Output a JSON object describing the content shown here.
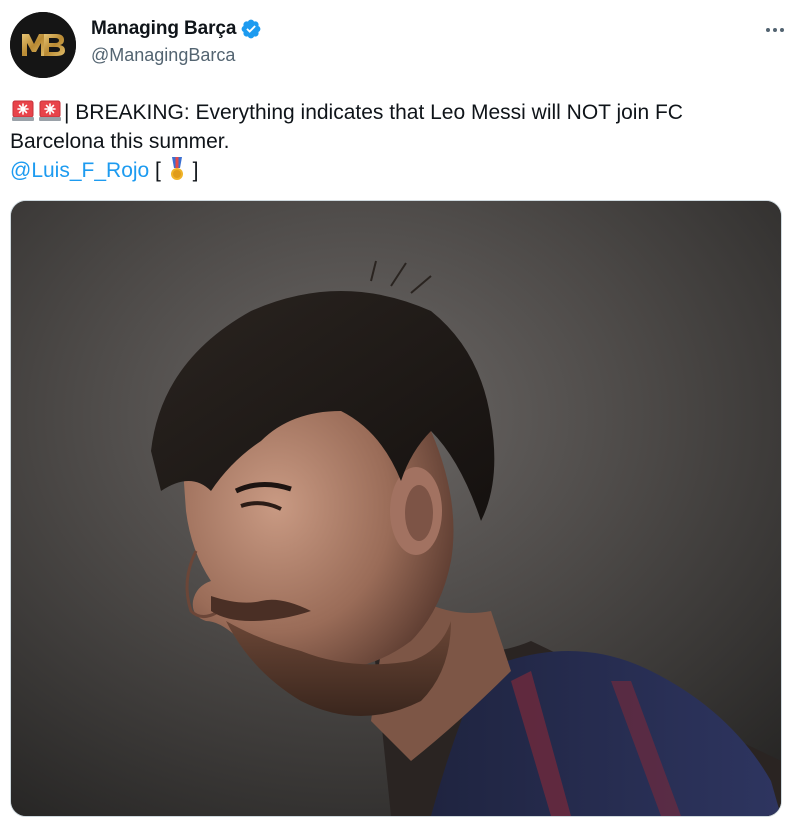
{
  "tweet": {
    "author": {
      "display_name": "Managing Barça",
      "handle": "@ManagingBarca",
      "verified": true,
      "avatar_monogram": "MB"
    },
    "text": {
      "line1": "| BREAKING: Everything indicates that Leo Messi will NOT join FC",
      "line2": "Barcelona this summer.",
      "mention": "@Luis_F_Rojo",
      "bracket_open": " [ ",
      "bracket_close": " ]"
    },
    "icons": {
      "siren": "rotating-light-icon",
      "medal": "military-medal-icon",
      "verified": "verified-badge-icon",
      "more": "more-options-icon"
    },
    "colors": {
      "verified_blue": "#1d9bf0",
      "mention_blue": "#1d9bf0",
      "avatar_gold": "#c9a14a"
    }
  }
}
